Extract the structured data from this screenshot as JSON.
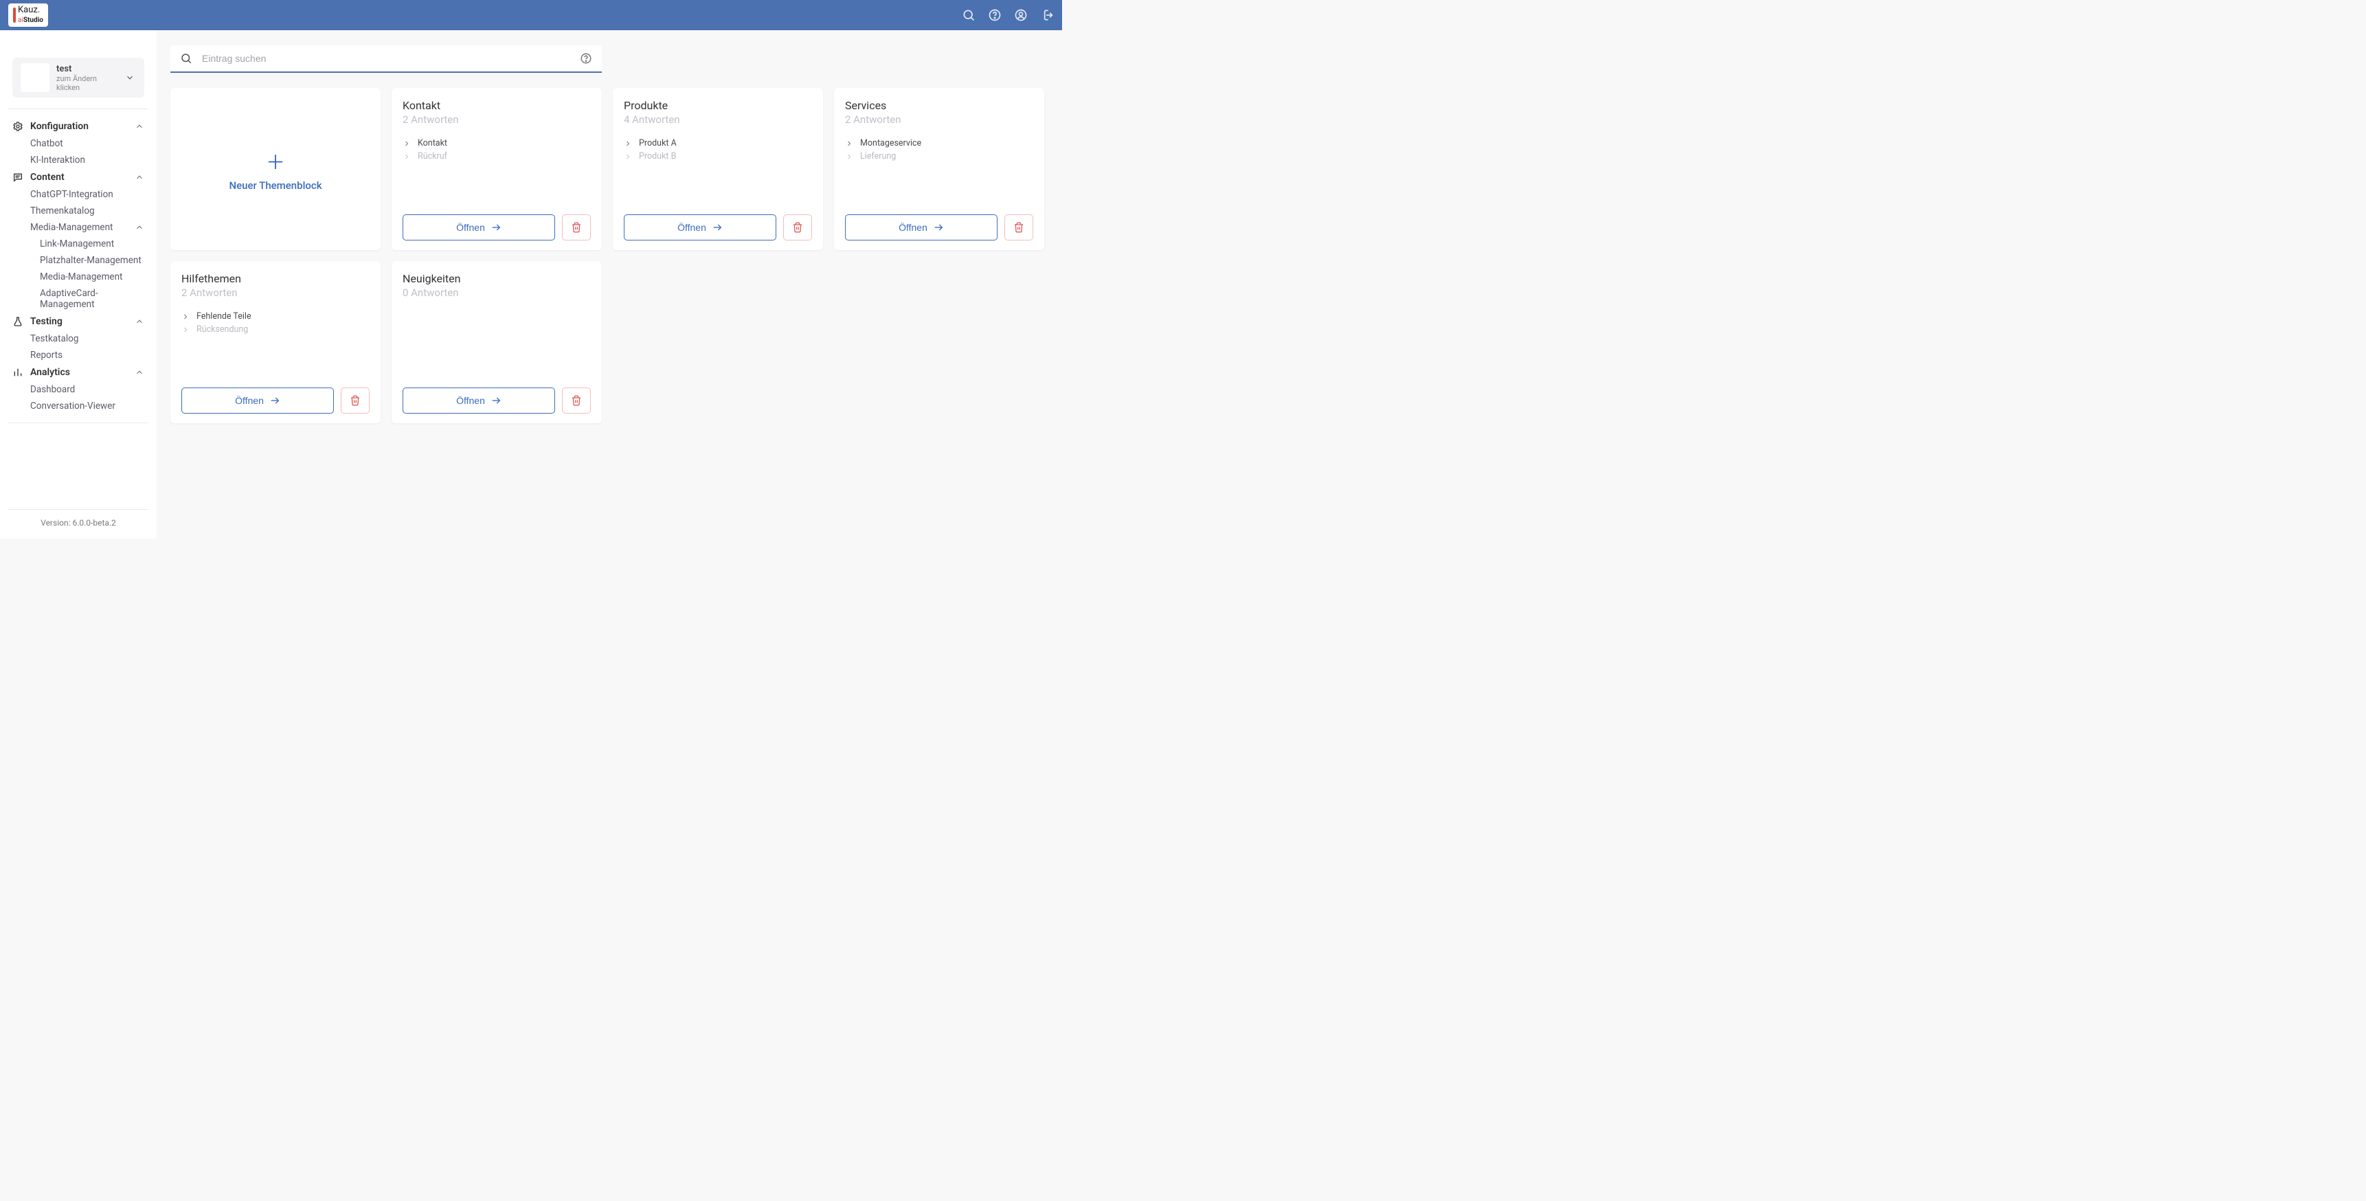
{
  "app": {
    "logo_top": "Kauz.",
    "logo_bottom_prefix": "ai",
    "logo_bottom_bold": "Studio"
  },
  "sidebar": {
    "project": {
      "name": "test",
      "hint": "zum Ändern klicken"
    },
    "sections": {
      "konfiguration": {
        "label": "Konfiguration"
      },
      "content": {
        "label": "Content"
      },
      "testing": {
        "label": "Testing"
      },
      "analytics": {
        "label": "Analytics"
      }
    },
    "items": {
      "chatbot": "Chatbot",
      "ki_interaktion": "KI-Interaktion",
      "chatgpt_integration": "ChatGPT-Integration",
      "themenkatalog": "Themenkatalog",
      "media_management": "Media-Management",
      "link_management": "Link-Management",
      "platzhalter_management": "Platzhalter-Management",
      "media_management_sub": "Media-Management",
      "adaptivecard_management": "AdaptiveCard-Management",
      "testkatalog": "Testkatalog",
      "reports": "Reports",
      "dashboard": "Dashboard",
      "conversation_viewer": "Conversation-Viewer"
    },
    "version_label": "Version: 6.0.0-beta.2"
  },
  "search": {
    "placeholder": "Eintrag suchen"
  },
  "new_card": {
    "label": "Neuer Themenblock"
  },
  "common": {
    "open": "Öffnen"
  },
  "cards": [
    {
      "title": "Kontakt",
      "subtitle": "2 Antworten",
      "items": [
        {
          "label": "Kontakt",
          "muted": false
        },
        {
          "label": "Rückruf",
          "muted": true
        }
      ]
    },
    {
      "title": "Produkte",
      "subtitle": "4 Antworten",
      "items": [
        {
          "label": "Produkt A",
          "muted": false
        },
        {
          "label": "Produkt B",
          "muted": true
        }
      ]
    },
    {
      "title": "Services",
      "subtitle": "2 Antworten",
      "items": [
        {
          "label": "Montageservice",
          "muted": false
        },
        {
          "label": "Lieferung",
          "muted": true
        }
      ]
    },
    {
      "title": "Hilfethemen",
      "subtitle": "2 Antworten",
      "items": [
        {
          "label": "Fehlende Teile",
          "muted": false
        },
        {
          "label": "Rücksendung",
          "muted": true
        }
      ]
    },
    {
      "title": "Neuigkeiten",
      "subtitle": "0 Antworten",
      "items": []
    }
  ]
}
